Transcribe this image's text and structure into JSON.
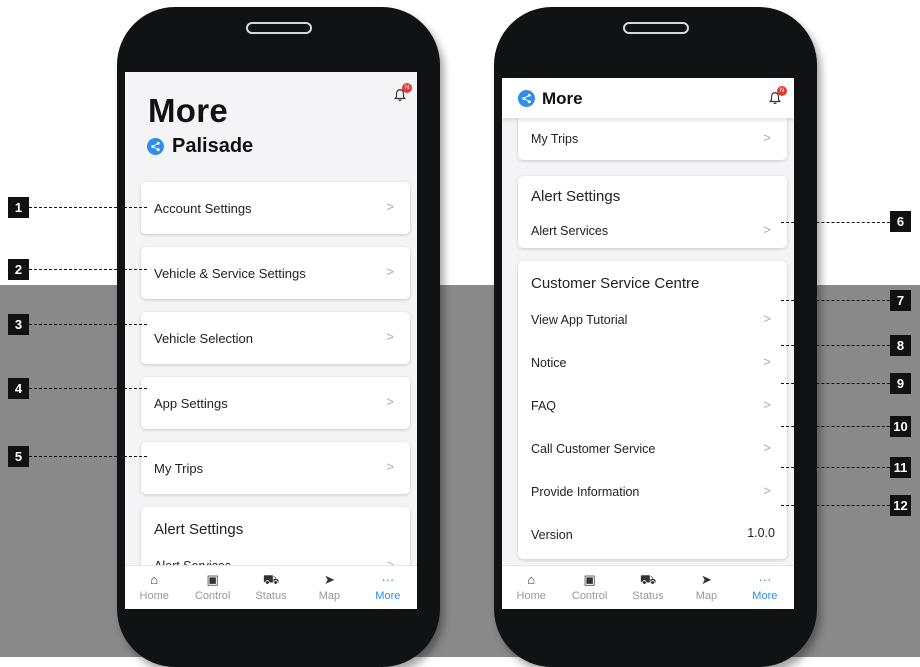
{
  "left_screen": {
    "title": "More",
    "vehicle": "Palisade",
    "notification_badge": "N",
    "menu": [
      {
        "label": "Account Settings"
      },
      {
        "label": "Vehicle & Service Settings"
      },
      {
        "label": "Vehicle Selection"
      },
      {
        "label": "App Settings"
      },
      {
        "label": "My Trips"
      }
    ],
    "alert_group": {
      "title": "Alert Settings",
      "item": "Alert Services"
    }
  },
  "right_screen": {
    "header_title": "More",
    "notification_badge": "N",
    "my_trips": "My Trips",
    "alert_group": {
      "title": "Alert Settings",
      "item": "Alert Services"
    },
    "service_group": {
      "title": "Customer Service Centre",
      "items": [
        {
          "label": "View App Tutorial"
        },
        {
          "label": "Notice"
        },
        {
          "label": "FAQ"
        },
        {
          "label": "Call Customer Service"
        },
        {
          "label": "Provide Information"
        }
      ],
      "version_label": "Version",
      "version_value": "1.0.0"
    }
  },
  "tabbar": {
    "tabs": [
      {
        "label": "Home",
        "icon": "home-icon"
      },
      {
        "label": "Control",
        "icon": "control-icon"
      },
      {
        "label": "Status",
        "icon": "car-icon"
      },
      {
        "label": "Map",
        "icon": "navigation-icon"
      },
      {
        "label": "More",
        "icon": "more-icon",
        "active": true
      }
    ]
  },
  "callouts": [
    "1",
    "2",
    "3",
    "4",
    "5",
    "6",
    "7",
    "8",
    "9",
    "10",
    "11",
    "12"
  ],
  "chevron": ">",
  "colors": {
    "accent": "#2e8eea",
    "badge": "#e53935",
    "band": "#898989",
    "phone": "#111214"
  }
}
